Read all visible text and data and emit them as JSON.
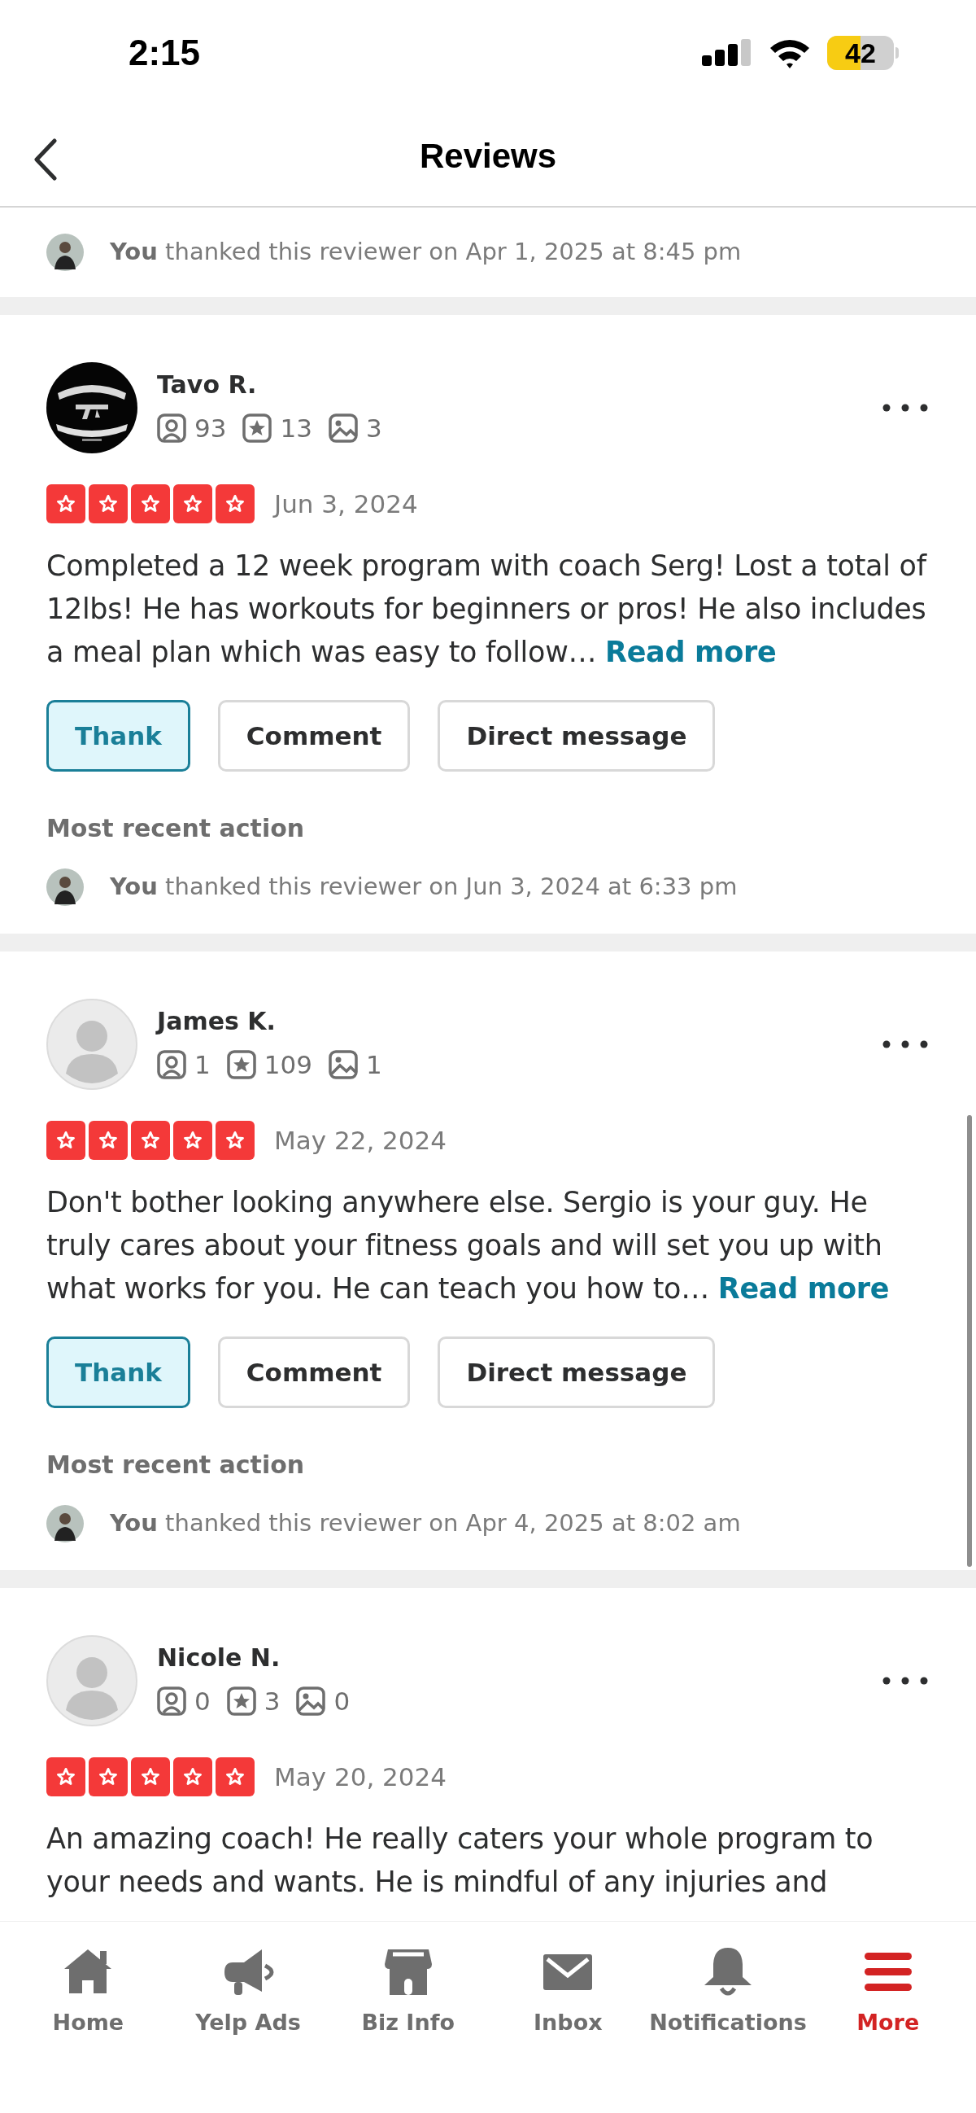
{
  "status_bar": {
    "time": "2:15",
    "battery": "42"
  },
  "header": {
    "title": "Reviews"
  },
  "top_action": {
    "actor": "You",
    "text": "thanked this reviewer on Apr 1, 2025 at 8:45 pm"
  },
  "reviews": [
    {
      "name": "Tavo R.",
      "stats": [
        "93",
        "13",
        "3"
      ],
      "stars": 5,
      "date": "Jun 3, 2024",
      "text": "Completed a 12 week program with coach Serg! Lost a total of 12lbs! He has workouts for beginners or pros! He also includes a meal plan which was easy to follow…",
      "read_more": "Read more",
      "actions": [
        {
          "label": "Thank",
          "selected": true
        },
        {
          "label": "Comment",
          "selected": false
        },
        {
          "label": "Direct message",
          "selected": false
        }
      ],
      "recent_heading": "Most recent action",
      "recent": {
        "actor": "You",
        "text": "thanked this reviewer on Jun 3, 2024 at 6:33 pm"
      }
    },
    {
      "name": "James K.",
      "avatar": {
        "kind": "default"
      },
      "stats": [
        "1",
        "109",
        "1"
      ],
      "stars": 5,
      "date": "May 22, 2024",
      "text": "Don't bother looking anywhere else. Sergio is your guy.  He truly cares about your fitness goals and will set you up with what works for you. He can teach you how to…",
      "read_more": "Read more",
      "actions": [
        {
          "label": "Thank",
          "selected": true
        },
        {
          "label": "Comment",
          "selected": false
        },
        {
          "label": "Direct message",
          "selected": false
        }
      ],
      "recent_heading": "Most recent action",
      "recent": {
        "actor": "You",
        "text": "thanked this reviewer on Apr 4, 2025 at 8:02 am"
      }
    },
    {
      "name": "Nicole N.",
      "avatar": {
        "kind": "default"
      },
      "stats": [
        "0",
        "3",
        "0"
      ],
      "stars": 5,
      "date": "May 20, 2024",
      "text": "An amazing coach! He really caters your whole program to your needs and wants. He is mindful of any injuries and"
    }
  ],
  "tab_bar": [
    {
      "kind": "home",
      "label": "Home",
      "selected": false
    },
    {
      "kind": "ads",
      "label": "Yelp Ads",
      "selected": false
    },
    {
      "kind": "biz",
      "label": "Biz Info",
      "selected": false
    },
    {
      "kind": "inbox",
      "label": "Inbox",
      "selected": false
    },
    {
      "kind": "bell",
      "label": "Notifications",
      "selected": false
    },
    {
      "kind": "more",
      "label": "More",
      "selected": true
    }
  ]
}
